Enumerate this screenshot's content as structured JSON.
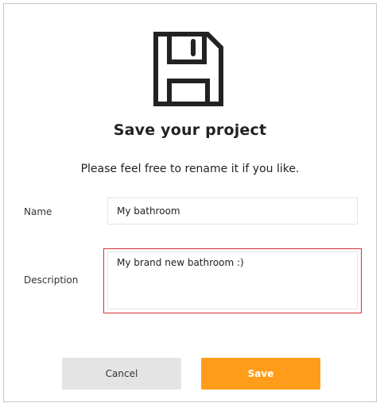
{
  "dialog": {
    "icon": "floppy-disk-icon",
    "title": "Save your project",
    "subtitle": "Please feel free to rename it if you like."
  },
  "form": {
    "name_label": "Name",
    "name_value": "My bathroom",
    "description_label": "Description",
    "description_value": "My brand new bathroom :)"
  },
  "actions": {
    "cancel_label": "Cancel",
    "save_label": "Save"
  },
  "colors": {
    "save_button": "#ff9c1a",
    "cancel_button": "#e4e4e4",
    "focus_outline": "#d5323a",
    "icon_stroke": "#222222"
  }
}
